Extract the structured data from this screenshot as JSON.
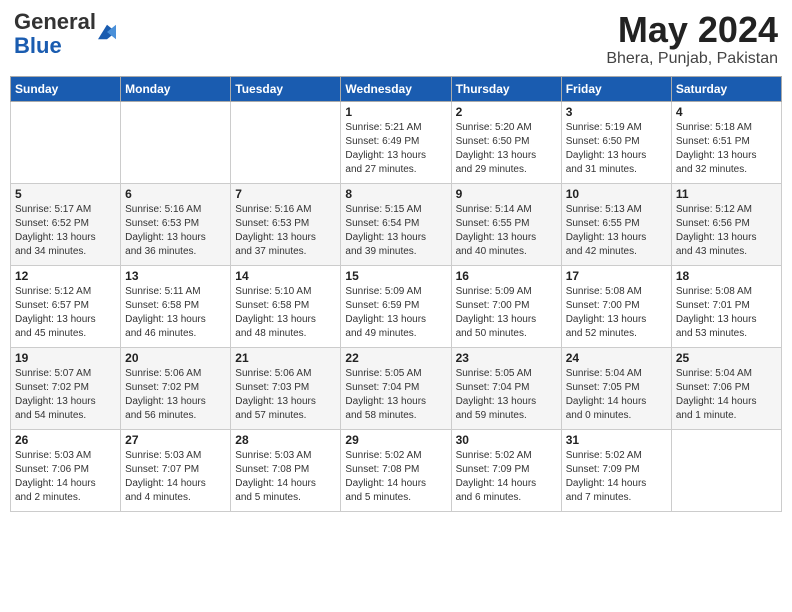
{
  "header": {
    "logo_general": "General",
    "logo_blue": "Blue",
    "title": "May 2024",
    "location": "Bhera, Punjab, Pakistan"
  },
  "weekdays": [
    "Sunday",
    "Monday",
    "Tuesday",
    "Wednesday",
    "Thursday",
    "Friday",
    "Saturday"
  ],
  "weeks": [
    [
      {
        "day": "",
        "text": ""
      },
      {
        "day": "",
        "text": ""
      },
      {
        "day": "",
        "text": ""
      },
      {
        "day": "1",
        "text": "Sunrise: 5:21 AM\nSunset: 6:49 PM\nDaylight: 13 hours\nand 27 minutes."
      },
      {
        "day": "2",
        "text": "Sunrise: 5:20 AM\nSunset: 6:50 PM\nDaylight: 13 hours\nand 29 minutes."
      },
      {
        "day": "3",
        "text": "Sunrise: 5:19 AM\nSunset: 6:50 PM\nDaylight: 13 hours\nand 31 minutes."
      },
      {
        "day": "4",
        "text": "Sunrise: 5:18 AM\nSunset: 6:51 PM\nDaylight: 13 hours\nand 32 minutes."
      }
    ],
    [
      {
        "day": "5",
        "text": "Sunrise: 5:17 AM\nSunset: 6:52 PM\nDaylight: 13 hours\nand 34 minutes."
      },
      {
        "day": "6",
        "text": "Sunrise: 5:16 AM\nSunset: 6:53 PM\nDaylight: 13 hours\nand 36 minutes."
      },
      {
        "day": "7",
        "text": "Sunrise: 5:16 AM\nSunset: 6:53 PM\nDaylight: 13 hours\nand 37 minutes."
      },
      {
        "day": "8",
        "text": "Sunrise: 5:15 AM\nSunset: 6:54 PM\nDaylight: 13 hours\nand 39 minutes."
      },
      {
        "day": "9",
        "text": "Sunrise: 5:14 AM\nSunset: 6:55 PM\nDaylight: 13 hours\nand 40 minutes."
      },
      {
        "day": "10",
        "text": "Sunrise: 5:13 AM\nSunset: 6:55 PM\nDaylight: 13 hours\nand 42 minutes."
      },
      {
        "day": "11",
        "text": "Sunrise: 5:12 AM\nSunset: 6:56 PM\nDaylight: 13 hours\nand 43 minutes."
      }
    ],
    [
      {
        "day": "12",
        "text": "Sunrise: 5:12 AM\nSunset: 6:57 PM\nDaylight: 13 hours\nand 45 minutes."
      },
      {
        "day": "13",
        "text": "Sunrise: 5:11 AM\nSunset: 6:58 PM\nDaylight: 13 hours\nand 46 minutes."
      },
      {
        "day": "14",
        "text": "Sunrise: 5:10 AM\nSunset: 6:58 PM\nDaylight: 13 hours\nand 48 minutes."
      },
      {
        "day": "15",
        "text": "Sunrise: 5:09 AM\nSunset: 6:59 PM\nDaylight: 13 hours\nand 49 minutes."
      },
      {
        "day": "16",
        "text": "Sunrise: 5:09 AM\nSunset: 7:00 PM\nDaylight: 13 hours\nand 50 minutes."
      },
      {
        "day": "17",
        "text": "Sunrise: 5:08 AM\nSunset: 7:00 PM\nDaylight: 13 hours\nand 52 minutes."
      },
      {
        "day": "18",
        "text": "Sunrise: 5:08 AM\nSunset: 7:01 PM\nDaylight: 13 hours\nand 53 minutes."
      }
    ],
    [
      {
        "day": "19",
        "text": "Sunrise: 5:07 AM\nSunset: 7:02 PM\nDaylight: 13 hours\nand 54 minutes."
      },
      {
        "day": "20",
        "text": "Sunrise: 5:06 AM\nSunset: 7:02 PM\nDaylight: 13 hours\nand 56 minutes."
      },
      {
        "day": "21",
        "text": "Sunrise: 5:06 AM\nSunset: 7:03 PM\nDaylight: 13 hours\nand 57 minutes."
      },
      {
        "day": "22",
        "text": "Sunrise: 5:05 AM\nSunset: 7:04 PM\nDaylight: 13 hours\nand 58 minutes."
      },
      {
        "day": "23",
        "text": "Sunrise: 5:05 AM\nSunset: 7:04 PM\nDaylight: 13 hours\nand 59 minutes."
      },
      {
        "day": "24",
        "text": "Sunrise: 5:04 AM\nSunset: 7:05 PM\nDaylight: 14 hours\nand 0 minutes."
      },
      {
        "day": "25",
        "text": "Sunrise: 5:04 AM\nSunset: 7:06 PM\nDaylight: 14 hours\nand 1 minute."
      }
    ],
    [
      {
        "day": "26",
        "text": "Sunrise: 5:03 AM\nSunset: 7:06 PM\nDaylight: 14 hours\nand 2 minutes."
      },
      {
        "day": "27",
        "text": "Sunrise: 5:03 AM\nSunset: 7:07 PM\nDaylight: 14 hours\nand 4 minutes."
      },
      {
        "day": "28",
        "text": "Sunrise: 5:03 AM\nSunset: 7:08 PM\nDaylight: 14 hours\nand 5 minutes."
      },
      {
        "day": "29",
        "text": "Sunrise: 5:02 AM\nSunset: 7:08 PM\nDaylight: 14 hours\nand 5 minutes."
      },
      {
        "day": "30",
        "text": "Sunrise: 5:02 AM\nSunset: 7:09 PM\nDaylight: 14 hours\nand 6 minutes."
      },
      {
        "day": "31",
        "text": "Sunrise: 5:02 AM\nSunset: 7:09 PM\nDaylight: 14 hours\nand 7 minutes."
      },
      {
        "day": "",
        "text": ""
      }
    ]
  ]
}
